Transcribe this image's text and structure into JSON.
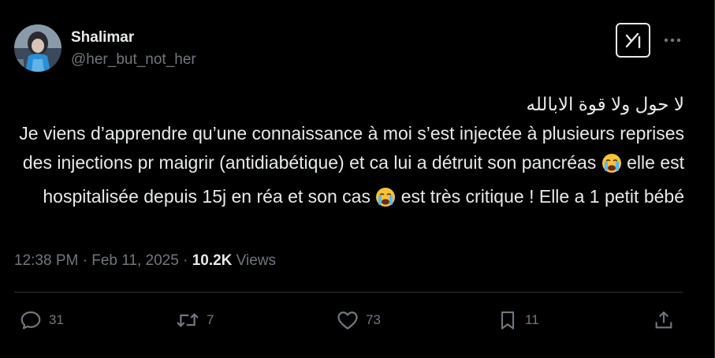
{
  "author": {
    "name": "Shalimar",
    "handle": "@her_but_not_her",
    "avatar": "avatar-photo"
  },
  "header_actions": {
    "grok_icon": "grok-icon",
    "more_icon": "more-horizontal-icon"
  },
  "tweet": {
    "lines": [
      "لا حول ولا قوة الابالله",
      "Je viens d’apprendre qu’une connaissance à moi s’est injectée à plusieurs reprises des injections pr maigrir (antidiabétique) et ca lui a détruit son pancréas"
    ],
    "mid_text": " elle est hospitalisée depuis 15j en réa et son cas ",
    "end_text": " est très critique ! Elle a 1 petit bébé",
    "emoji": "loudly-crying-face-emoji"
  },
  "meta": {
    "time": "12:38 PM",
    "separator": " · ",
    "date": "Feb 11, 2025",
    "views_count": "10.2K",
    "views_label": " Views"
  },
  "actions": {
    "replies": {
      "icon": "reply-icon",
      "count": "31"
    },
    "reposts": {
      "icon": "repost-icon",
      "count": "7"
    },
    "likes": {
      "icon": "heart-icon",
      "count": "73"
    },
    "bookmarks": {
      "icon": "bookmark-icon",
      "count": "11"
    },
    "share": {
      "icon": "share-icon"
    }
  },
  "colors": {
    "background": "#000000",
    "primary_text": "#e7e9ea",
    "secondary_text": "#71767b",
    "divider": "#2f3336"
  }
}
